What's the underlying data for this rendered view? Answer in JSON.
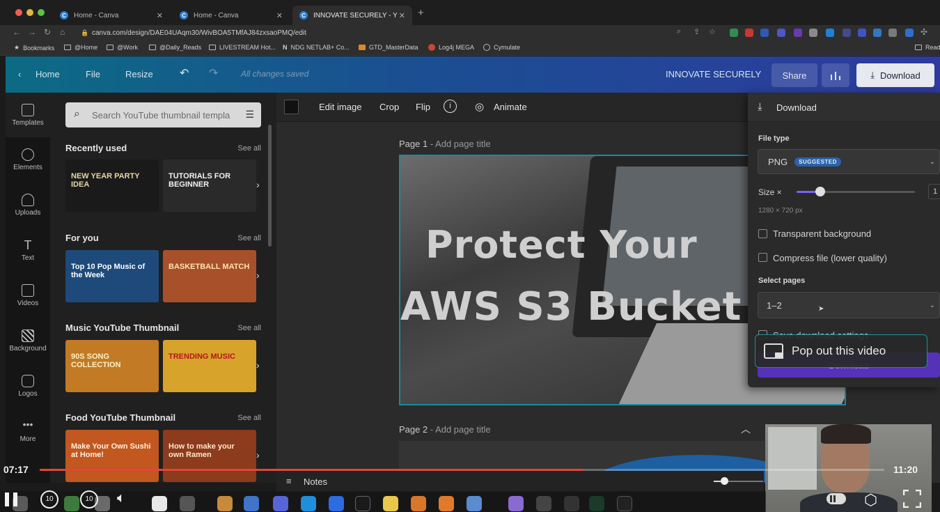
{
  "browser": {
    "tabs": [
      {
        "title": "Home - Canva",
        "active": false
      },
      {
        "title": "Home - Canva",
        "active": false
      },
      {
        "title": "INNOVATE SECURELY - YouTub",
        "active": true
      }
    ],
    "new_tab_glyph": "+",
    "url": "canva.com/design/DAE04UAqm30/WivBOA5TMfAJ84zxsaoPMQ/edit",
    "bookmarks": [
      "Bookmarks",
      "@Home",
      "@Work",
      "@Daily_Reads",
      "LIVESTREAM Hot...",
      "NDG NETLAB+ Co...",
      "GTD_MasterData",
      "Log4j MEGA",
      "Cymulate"
    ],
    "reading_list": "Read"
  },
  "canva": {
    "topbar": {
      "home": "Home",
      "file": "File",
      "resize": "Resize",
      "saved_status": "All changes saved",
      "design_title": "INNOVATE SECURELY",
      "share": "Share",
      "download": "Download"
    },
    "rail": [
      "Templates",
      "Elements",
      "Uploads",
      "Text",
      "Videos",
      "Background",
      "Logos",
      "More"
    ],
    "panel": {
      "search_placeholder": "Search YouTube thumbnail templa",
      "see_all": "See all",
      "sections": [
        {
          "title": "Recently used",
          "thumbs": [
            {
              "text": "NEW YEAR PARTY IDEA",
              "bg": "#1a1a1a",
              "fg": "#e6d7a8"
            },
            {
              "text": "TUTORIALS FOR BEGINNER",
              "bg": "#2a2a2a",
              "fg": "#f2f2f2"
            }
          ]
        },
        {
          "title": "For you",
          "thumbs": [
            {
              "text": "Top 10 Pop Music of the Week",
              "bg": "#1d4a7a",
              "fg": "#ffffff"
            },
            {
              "text": "BASKETBALL MATCH",
              "bg": "#a8502a",
              "fg": "#ffe3b0"
            }
          ]
        },
        {
          "title": "Music YouTube Thumbnail",
          "thumbs": [
            {
              "text": "90S SONG COLLECTION",
              "bg": "#c27a25",
              "fg": "#fff0c8"
            },
            {
              "text": "TRENDING MUSIC",
              "bg": "#d8a32a",
              "fg": "#b4171c"
            }
          ]
        },
        {
          "title": "Food YouTube Thumbnail",
          "thumbs": [
            {
              "text": "Make Your Own Sushi at Home!",
              "bg": "#c2571f",
              "fg": "#fff2e0"
            },
            {
              "text": "How to make your own Ramen",
              "bg": "#8c3b1c",
              "fg": "#ffe7c8"
            }
          ]
        }
      ]
    },
    "toolbar": {
      "edit_image": "Edit image",
      "crop": "Crop",
      "flip": "Flip",
      "animate": "Animate"
    },
    "pages": [
      {
        "label": "Page 1",
        "hint": "- Add page title",
        "headline_1": "Protect Your",
        "headline_2": "AWS S3 Bucket"
      },
      {
        "label": "Page 2",
        "hint": "- Add page title"
      }
    ],
    "notes": "Notes",
    "download_panel": {
      "title": "Download",
      "file_type_label": "File type",
      "file_type": "PNG",
      "suggested": "SUGGESTED",
      "size_label": "Size ×",
      "size_value": "1",
      "size_fraction": 0.2,
      "dimensions": "1280 × 720 px",
      "transparent_bg": "Transparent background",
      "compress": "Compress file (lower quality)",
      "select_pages_label": "Select pages",
      "pages_value": "1–2",
      "save_settings": "Save download settings",
      "download_button": "Download"
    }
  },
  "video_player": {
    "current_time": "07:17",
    "duration": "11:20",
    "progress_fraction": 0.643,
    "skip_back": "10",
    "skip_forward": "10",
    "popout_label": "Pop out this video"
  }
}
